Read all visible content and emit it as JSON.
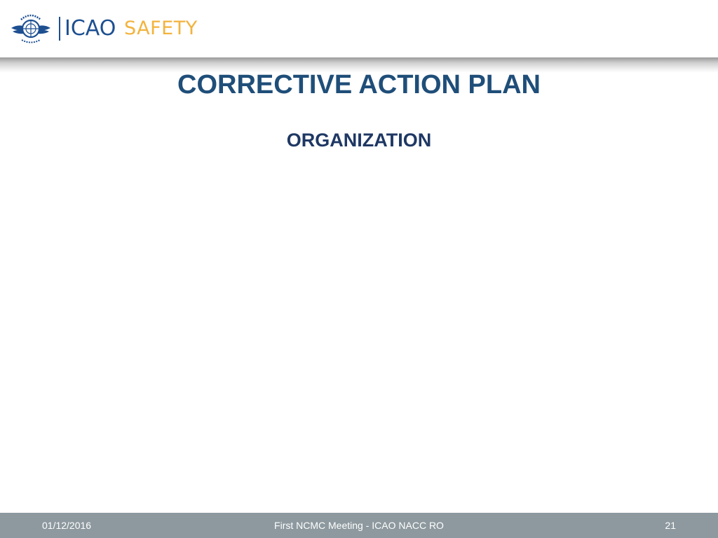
{
  "header": {
    "logo_text": "ICAO",
    "logo_tagline": "SAFETY",
    "emblem_icon": "un-icao-emblem-icon",
    "colors": {
      "brand_blue": "#1d4f91",
      "tagline_gold": "#f2b33d"
    }
  },
  "slide": {
    "title": "CORRECTIVE ACTION PLAN",
    "subtitle": "ORGANIZATION",
    "colors": {
      "title": "#1f4e79",
      "subtitle": "#1f3864"
    }
  },
  "footer": {
    "date": "01/12/2016",
    "center_text": "First NCMC Meeting - ICAO NACC RO",
    "page_number": "21",
    "colors": {
      "background": "#8d999f",
      "text": "#ffffff"
    }
  }
}
